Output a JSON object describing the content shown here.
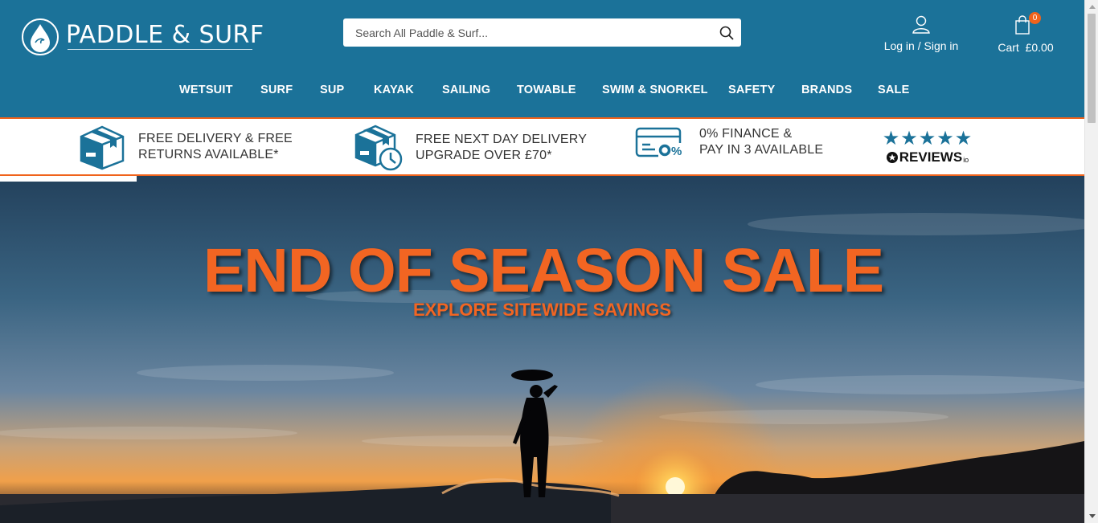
{
  "brand": {
    "name": "PADDLE & SURF"
  },
  "search": {
    "placeholder": "Search All Paddle & Surf..."
  },
  "account": {
    "label": "Log in / Sign in"
  },
  "cart": {
    "label": "Cart  £0.00",
    "count": "0"
  },
  "nav": [
    "WETSUIT",
    "SURF",
    "SUP",
    "KAYAK",
    "SAILING",
    "TOWABLE",
    "SWIM & SNORKEL",
    "SAFETY",
    "BRANDS",
    "SALE"
  ],
  "usps": [
    {
      "line1": "FREE DELIVERY & FREE",
      "line2": "RETURNS AVAILABLE*",
      "icon": "delivery-box-icon"
    },
    {
      "line1": "FREE NEXT DAY DELIVERY",
      "line2": "UPGRADE OVER £70*",
      "icon": "delivery-clock-icon"
    },
    {
      "line1": "0% FINANCE &",
      "line2": "PAY IN 3 AVAILABLE",
      "icon": "card-finance-icon"
    }
  ],
  "reviews": {
    "stars": "★★★★★",
    "rating": 5,
    "name": "REVIEWS",
    "suffix": "io"
  },
  "hero": {
    "title": "END OF SEASON SALE",
    "subtitle": "EXPLORE SITEWIDE SAVINGS"
  },
  "colors": {
    "brand_blue": "#1b7299",
    "accent_orange": "#f0631c",
    "hero_orange": "#f26522"
  }
}
